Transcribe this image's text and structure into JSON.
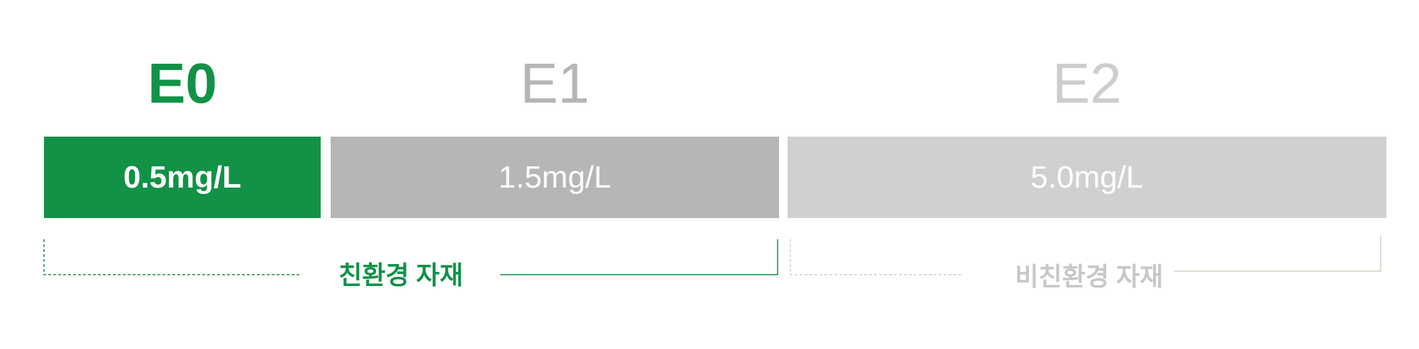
{
  "grades": [
    {
      "label": "E0",
      "value": "0.5mg/L"
    },
    {
      "label": "E1",
      "value": "1.5mg/L"
    },
    {
      "label": "E2",
      "value": "5.0mg/L"
    }
  ],
  "categories": {
    "eco": "친환경 자재",
    "non_eco": "비친환경 자재"
  },
  "colors": {
    "eco_green": "#119246",
    "e1_gray": "#b6b6b6",
    "e2_gray": "#d2cfd0",
    "non_eco_text": "#c9c6c7"
  }
}
